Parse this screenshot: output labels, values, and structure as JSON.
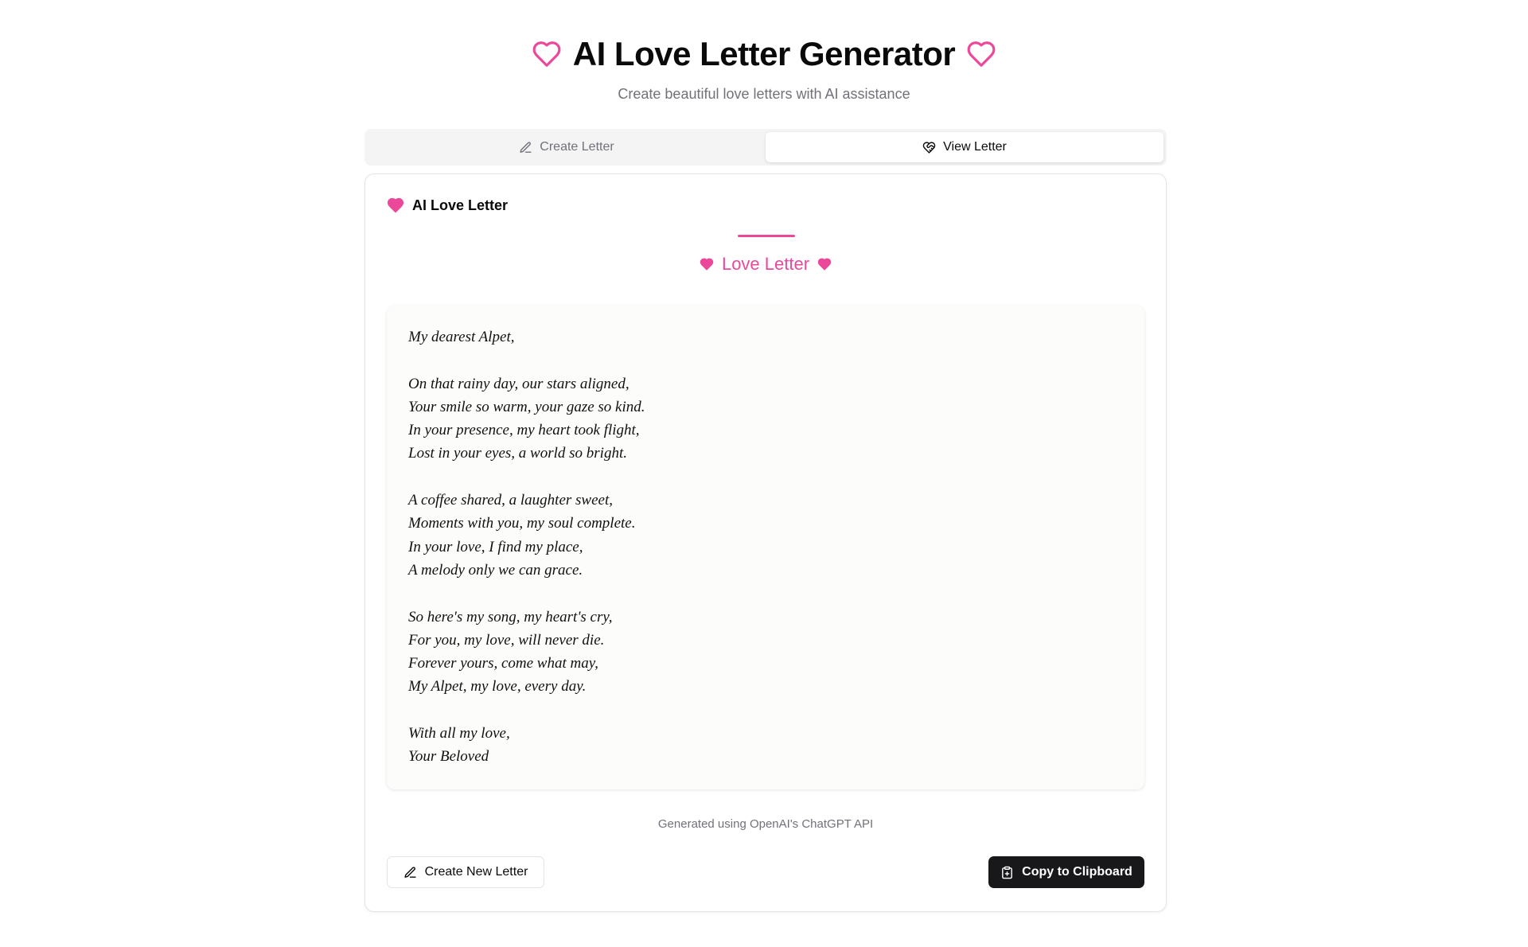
{
  "header": {
    "title": "AI Love Letter Generator",
    "subtitle": "Create beautiful love letters with AI assistance",
    "icon": "heart-outline-icon"
  },
  "tabs": [
    {
      "label": "Create Letter",
      "icon": "pencil-icon",
      "active": false
    },
    {
      "label": "View Letter",
      "icon": "heart-handshake-icon",
      "active": true
    }
  ],
  "card": {
    "title": "AI Love Letter",
    "letter_heading": "Love Letter",
    "letter_lines": [
      "My dearest Alpet,",
      "",
      "On that rainy day, our stars aligned,",
      "Your smile so warm, your gaze so kind.",
      "In your presence, my heart took flight,",
      "Lost in your eyes, a world so bright.",
      "",
      "A coffee shared, a laughter sweet,",
      "Moments with you, my soul complete.",
      "In your love, I find my place,",
      "A melody only we can grace.",
      "",
      "So here's my song, my heart's cry,",
      "For you, my love, will never die.",
      "Forever yours, come what may,",
      "My Alpet, my love, every day.",
      "",
      "With all my love,",
      "Your Beloved"
    ],
    "footer_note": "Generated using OpenAI's ChatGPT API",
    "create_new_label": "Create New Letter",
    "copy_label": "Copy to Clipboard"
  },
  "colors": {
    "accent": "#ec4899",
    "button_dark": "#18181b",
    "muted_text": "#71717a"
  }
}
